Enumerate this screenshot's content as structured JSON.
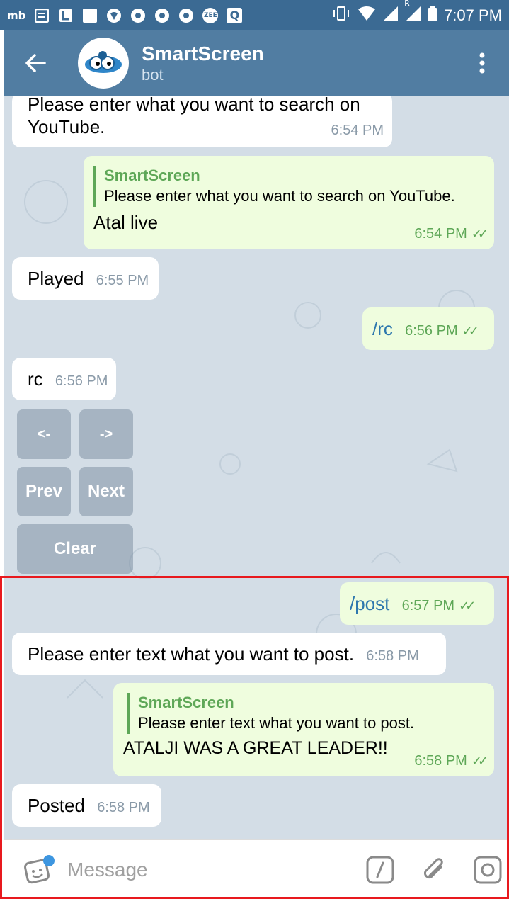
{
  "status_bar": {
    "mb": "mb",
    "zee": "ZEE",
    "q": "Q",
    "r": "R",
    "time": "7:07 PM"
  },
  "header": {
    "title": "SmartScreen",
    "subtitle": "bot"
  },
  "messages": [
    {
      "text": "Please enter what you want to search on YouTube.",
      "time": "6:54 PM"
    },
    {
      "reply_name": "SmartScreen",
      "reply_text": "Please enter what you want to search on YouTube.",
      "text": "Atal live",
      "time": "6:54 PM"
    },
    {
      "text": "Played",
      "time": "6:55 PM"
    },
    {
      "text": "/rc",
      "time": "6:56 PM"
    },
    {
      "text": "rc",
      "time": "6:56 PM"
    },
    {
      "text": "/post",
      "time": "6:57 PM"
    },
    {
      "text": "Please enter text what you want to post.",
      "time": "6:58 PM"
    },
    {
      "reply_name": "SmartScreen",
      "reply_text": "Please enter text what you want to post.",
      "text": "ATALJI WAS A GREAT LEADER!!",
      "time": "6:58 PM"
    },
    {
      "text": "Posted",
      "time": "6:58 PM"
    }
  ],
  "keyboard": {
    "left": "<-",
    "right": "->",
    "prev": "Prev",
    "next": "Next",
    "clear": "Clear"
  },
  "input": {
    "placeholder": "Message"
  },
  "colors": {
    "header": "#517da2",
    "status_bar": "#3b6a93",
    "chat_bg": "#d3dde6",
    "incoming_bubble": "#ffffff",
    "outgoing_bubble": "#effdde",
    "accent_green": "#5ea757",
    "highlight_border": "#e8191e"
  }
}
